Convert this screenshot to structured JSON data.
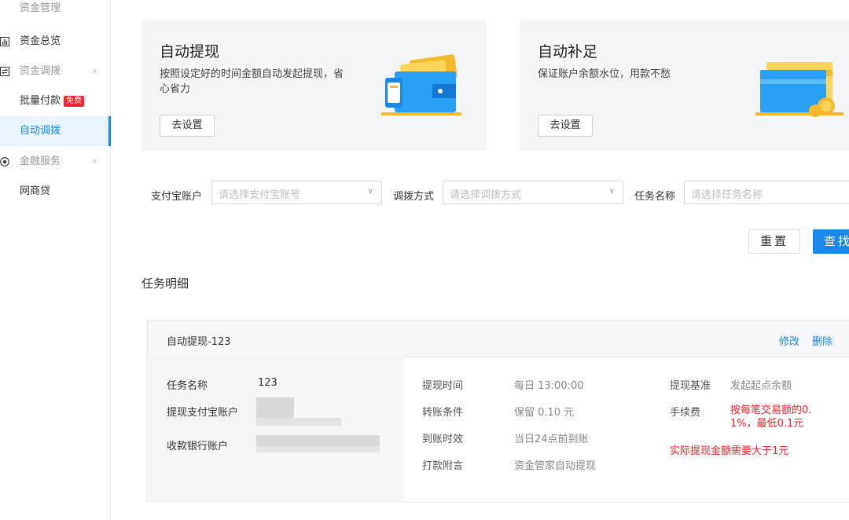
{
  "sidebar": {
    "top_label": "资金管理",
    "items": [
      {
        "label": "资金总览",
        "icon": "bar-chart-icon"
      },
      {
        "label": "资金调拨",
        "icon": "transfer-icon"
      },
      {
        "label": "批量付款",
        "badge": "免费"
      },
      {
        "label": "自动调拨",
        "active": true
      },
      {
        "label": "金融服务",
        "icon": "target-icon"
      },
      {
        "label": "网商贷"
      }
    ]
  },
  "cards": [
    {
      "title": "自动提现",
      "desc": "按照设定好的时间金额自动发起提现，省心省力",
      "button": "去设置",
      "image": "wallet-illustration"
    },
    {
      "title": "自动补足",
      "desc": "保证账户余额水位，用款不愁",
      "button": "去设置",
      "image": "card-coins-illustration"
    }
  ],
  "filters": {
    "alipay_label": "支付宝账户",
    "alipay_placeholder": "请选择支付宝账号",
    "method_label": "调拨方式",
    "method_placeholder": "请选择调拨方式",
    "task_label": "任务名称",
    "task_placeholder": "请选择任务名称"
  },
  "actions": {
    "reset": "重置",
    "search": "查找"
  },
  "section_title": "任务明细",
  "task": {
    "name": "自动提现-123",
    "edit": "修改",
    "delete": "删除",
    "left": {
      "task_name_label": "任务名称",
      "task_name_value": "123",
      "alipay_label": "提现支付宝账户",
      "bank_label": "收款银行账户"
    },
    "middle": [
      {
        "label": "提现时间",
        "value": "每日 13:00:00"
      },
      {
        "label": "转账条件",
        "value": "保留 0.10 元"
      },
      {
        "label": "到账时效",
        "value": "当日24点前到账"
      },
      {
        "label": "打款附言",
        "value": "资金管家自动提现"
      }
    ],
    "right": {
      "basis_label": "提现基准",
      "basis_value": "发起起点余额",
      "fee_label": "手续费",
      "fee_value_line1": "按每笔交易额的0.",
      "fee_value_line2": "1%，最低0.1元",
      "note": "实际提现金额需要大于1元"
    }
  },
  "colors": {
    "accent": "#1a88e8",
    "danger": "#f5222d",
    "card_bg": "#f5f6f8"
  }
}
